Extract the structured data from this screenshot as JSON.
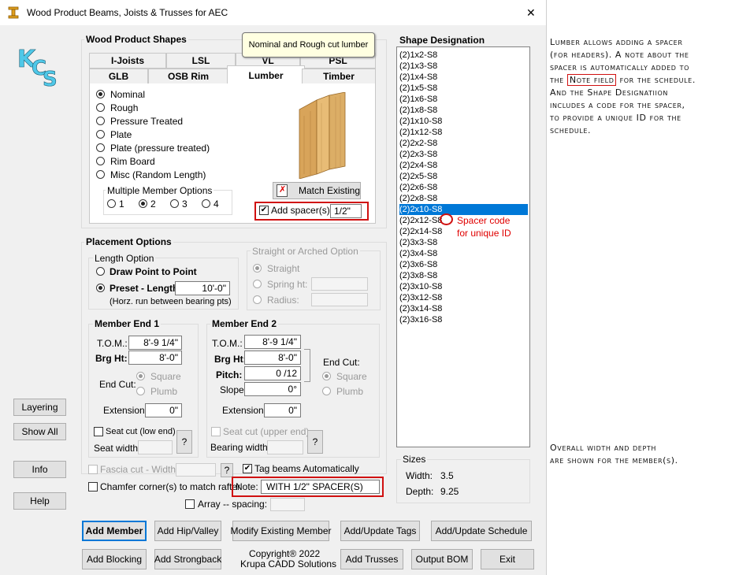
{
  "window": {
    "title": "Wood Product Beams, Joists & Trusses for AEC",
    "close_glyph": "✕"
  },
  "logo": "KCS",
  "tooltip": "Nominal and Rough cut lumber",
  "shapes": {
    "title": "Wood Product Shapes",
    "tabs_row1": [
      "I-Joists",
      "LSL",
      "VL",
      "PSL"
    ],
    "tabs_row2": [
      "GLB",
      "OSB Rim",
      "Lumber",
      "Timber"
    ],
    "radios": [
      "Nominal",
      "Rough",
      "Pressure Treated",
      "Plate",
      "Plate (pressure treated)",
      "Rim Board",
      "Misc (Random Length)"
    ],
    "selected_radio": "Nominal",
    "multi_title": "Multiple Member Options",
    "multi_opts": [
      "1",
      "2",
      "3",
      "4"
    ],
    "multi_selected": "2",
    "match_existing": "Match Existing",
    "add_spacer_label": "Add spacer(s):",
    "spacer_value": "1/2\""
  },
  "placement": {
    "title": "Placement Options",
    "length_title": "Length Option",
    "draw_point": "Draw Point to Point",
    "preset_length": "Preset - Length:",
    "preset_value": "10'-0\"",
    "horz_note": "(Horz. run  between bearing pts)",
    "straight_title": "Straight or Arched Option",
    "straight": "Straight",
    "spring_ht": "Spring ht:",
    "radius": "Radius:"
  },
  "end1": {
    "title": "Member End 1",
    "tom_label": "T.O.M.:",
    "tom_value": "8'-9 1/4\"",
    "brg_label": "Brg Ht:",
    "brg_value": "8'-0\"",
    "endcut_label": "End Cut:",
    "square": "Square",
    "plumb": "Plumb",
    "ext_label": "Extension:",
    "ext_value": "0\"",
    "seat_cut": "Seat cut (low end)",
    "seat_width": "Seat width:",
    "help_q": "?"
  },
  "end2": {
    "title": "Member End 2",
    "tom_label": "T.O.M.:",
    "tom_value": "8'-9 1/4\"",
    "brg_label": "Brg Ht:",
    "brg_value": "8'-0\"",
    "pitch_label": "Pitch:",
    "pitch_value": "0 /12",
    "slope_label": "Slope:",
    "slope_value": "0°",
    "endcut_label": "End Cut:",
    "square": "Square",
    "plumb": "Plumb",
    "ext_label": "Extension:",
    "ext_value": "0\"",
    "seat_cut": "Seat cut (upper end)",
    "bearing_width": "Bearing width:",
    "help_q": "?"
  },
  "misc": {
    "fascia": "Fascia cut - Width:",
    "help_q": "?",
    "tag_beams": "Tag beams Automatically",
    "chamfer": "Chamfer corner(s) to match rafter",
    "note_label": "Note:",
    "note_value": "WITH 1/2\" SPACER(S)",
    "array": "Array -- spacing:"
  },
  "designation": {
    "title": "Shape Designation",
    "items": [
      "(2)1x2-S8",
      "(2)1x3-S8",
      "(2)1x4-S8",
      "(2)1x5-S8",
      "(2)1x6-S8",
      "(2)1x8-S8",
      "(2)1x10-S8",
      "(2)1x12-S8",
      "(2)2x2-S8",
      "(2)2x3-S8",
      "(2)2x4-S8",
      "(2)2x5-S8",
      "(2)2x6-S8",
      "(2)2x8-S8",
      "(2)2x10-S8",
      "(2)2x12-S8",
      "(2)2x14-S8",
      "(2)3x3-S8",
      "(2)3x4-S8",
      "(2)3x6-S8",
      "(2)3x8-S8",
      "(2)3x10-S8",
      "(2)3x12-S8",
      "(2)3x14-S8",
      "(2)3x16-S8"
    ],
    "selected": "(2)2x10-S8",
    "spacer_note_1": "Spacer code",
    "spacer_note_2": "for unique ID"
  },
  "sizes": {
    "title": "Sizes",
    "width_label": "Width:",
    "width_value": "3.5",
    "depth_label": "Depth:",
    "depth_value": "9.25"
  },
  "side_buttons": {
    "layering": "Layering",
    "show_all": "Show All",
    "info": "Info",
    "help": "Help"
  },
  "bottom": {
    "add_member": "Add Member",
    "add_hip": "Add Hip/Valley",
    "modify": "Modify Existing Member",
    "add_tags": "Add/Update Tags",
    "add_schedule": "Add/Update Schedule",
    "add_blocking": "Add Blocking",
    "add_strongback": "Add Strongback",
    "copyright_1": "Copyright® 2022",
    "copyright_2": "Krupa CADD Solutions",
    "add_trusses": "Add Trusses",
    "output_bom": "Output BOM",
    "exit": "Exit"
  },
  "annotations": {
    "top": [
      "Lumber allows adding a spacer",
      "(for headers).  A note about the",
      "spacer is automatically added to",
      "the |Note field| for the schedule.",
      "And the Shape Designatiion",
      "includes a code for the spacer,",
      "to provide a unique ID for the",
      "schedule."
    ],
    "top_pre": "the ",
    "top_box": "Note field",
    "top_post": " for the schedule.",
    "bottom_1": "Overall width and depth",
    "bottom_2": "are shown for the member(s)."
  },
  "colors": {
    "selection": "#0078d7",
    "highlight_red": "#d01010"
  }
}
